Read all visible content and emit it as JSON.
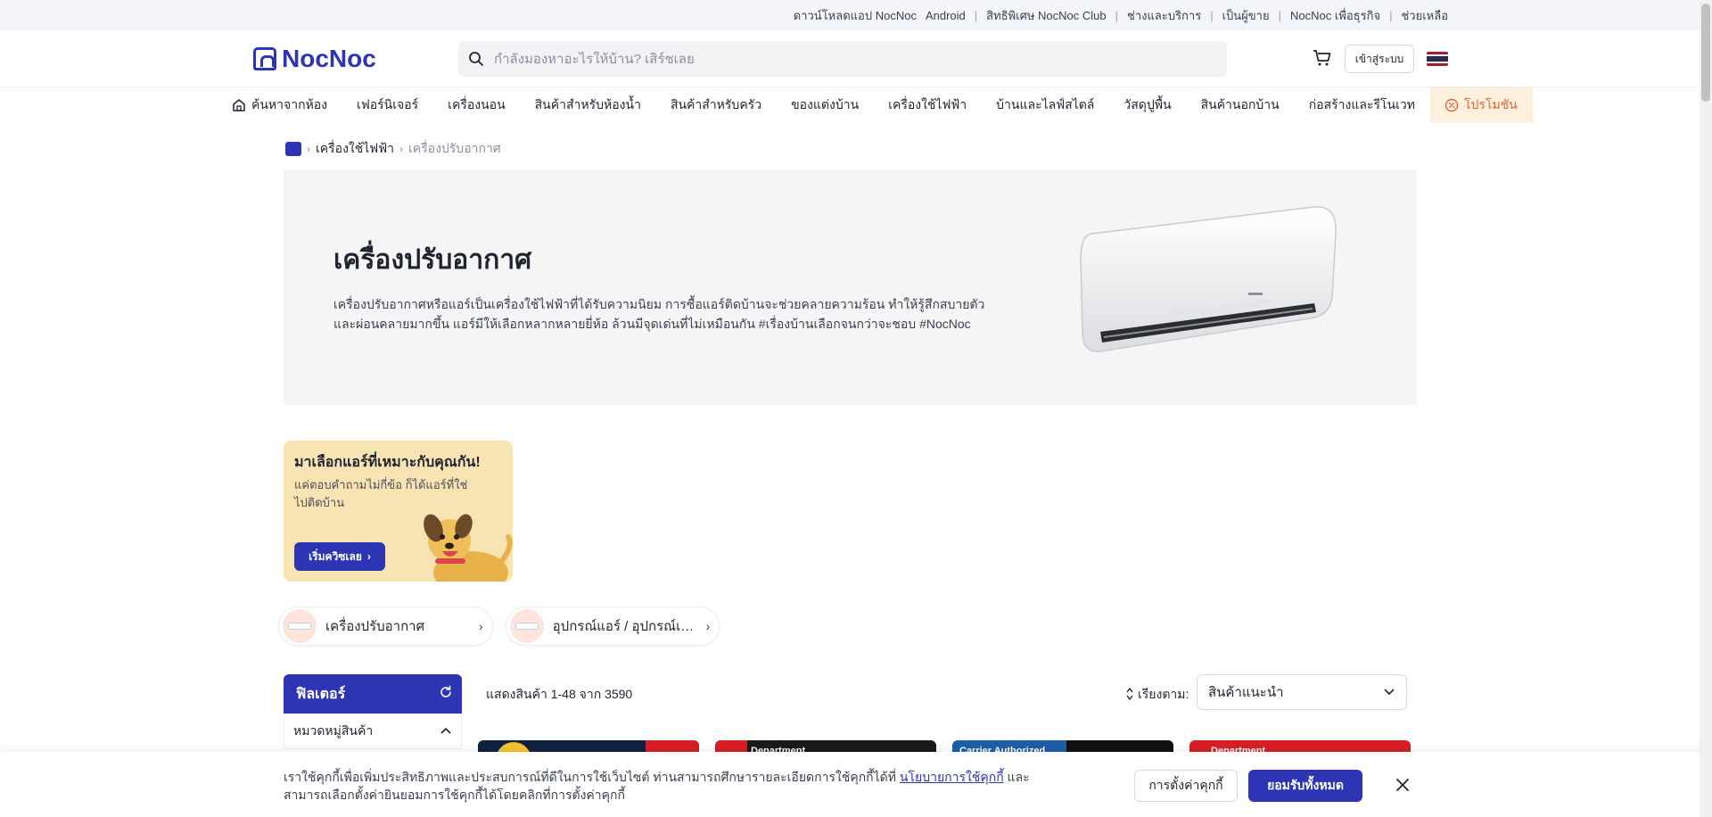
{
  "topbar": {
    "links": [
      {
        "label": "ดาวน์โหลดแอป NocNoc"
      },
      {
        "label": "Android"
      },
      {
        "label": "สิทธิพิเศษ NocNoc Club"
      },
      {
        "label": "ช่างและบริการ"
      },
      {
        "label": "เป็นผู้ขาย"
      },
      {
        "label": "NocNoc เพื่อธุรกิจ"
      },
      {
        "label": "ช่วยเหลือ"
      }
    ]
  },
  "header": {
    "logo_text": "NocNoc",
    "search_placeholder": "กำลังมองหาอะไรให้บ้าน? เสิร์ชเลย",
    "login_label": "เข้าสู่ระบบ"
  },
  "nav": {
    "items": [
      {
        "label": "ค้นหาจากห้อง"
      },
      {
        "label": "เฟอร์นิเจอร์"
      },
      {
        "label": "เครื่องนอน"
      },
      {
        "label": "สินค้าสำหรับห้องน้ำ"
      },
      {
        "label": "สินค้าสำหรับครัว"
      },
      {
        "label": "ของแต่งบ้าน"
      },
      {
        "label": "เครื่องใช้ไฟฟ้า"
      },
      {
        "label": "บ้านและไลฟ์สไตล์"
      },
      {
        "label": "วัสดุปูพื้น"
      },
      {
        "label": "สินค้านอกบ้าน"
      },
      {
        "label": "ก่อสร้างและรีโนเวท"
      },
      {
        "label": "โปรโมชัน"
      }
    ]
  },
  "breadcrumb": {
    "level1": "เครื่องใช้ไฟฟ้า",
    "current": "เครื่องปรับอากาศ"
  },
  "hero": {
    "title": "เครื่องปรับอากาศ",
    "description": "เครื่องปรับอากาศหรือแอร์เป็นเครื่องใช้ไฟฟ้าที่ได้รับความนิยม การซื้อแอร์ติดบ้านจะช่วยคลายความร้อน ทำให้รู้สึกสบายตัวและผ่อนคลายมากขึ้น แอร์มีให้เลือกหลากหลายยี่ห้อ ล้วนมีจุดเด่นที่ไม่เหมือนกัน #เรื่องบ้านเลือกจนกว่าจะชอบ #NocNoc"
  },
  "quiz": {
    "title": "มาเลือกแอร์ที่เหมาะกับคุณกัน!",
    "subtitle": "แค่ตอบคำถามไม่กี่ข้อ ก็ได้แอร์ที่ใช่ไปติดบ้าน",
    "button": "เริ่มควิซเลย"
  },
  "chips": [
    {
      "label": "เครื่องปรับอากาศ"
    },
    {
      "label": "อุปกรณ์แอร์ / อุปกรณ์เสริมแอร์"
    }
  ],
  "filter": {
    "title": "ฟิลเตอร์",
    "section": "หมวดหมู่สินค้า"
  },
  "results": {
    "count_text": "แสดงสินค้า 1-48 จาก 3590",
    "sort_label": "เรียงตาม:",
    "sort_value": "สินค้าแนะนำ"
  },
  "product_tags": [
    {
      "label": ""
    },
    {
      "label": "Department"
    },
    {
      "label": "Carrier Authorized"
    },
    {
      "label": "Department"
    }
  ],
  "cookie": {
    "text_before": "เราใช้คุกกี้เพื่อเพิ่มประสิทธิภาพและประสบการณ์ที่ดีในการใช้เว็บไซต์ ท่านสามารถศึกษารายละเอียดการใช้คุกกี้ได้ที่ ",
    "link": "นโยบายการใช้คุกกี้",
    "text_after": " และสามารถเลือกตั้งค่ายินยอมการใช้คุกกี้ได้โดยคลิกที่การตั้งค่าคุกกี้",
    "settings_label": "การตั้งค่าคุกกี้",
    "accept_label": "ยอมรับทั้งหมด"
  },
  "colors": {
    "brand": "#2d35b5",
    "promo_bg": "#fdf0dd",
    "promo_text": "#e0663a",
    "quiz_bg": "#f8e3b3",
    "hero_bg": "#f5f5f5"
  }
}
